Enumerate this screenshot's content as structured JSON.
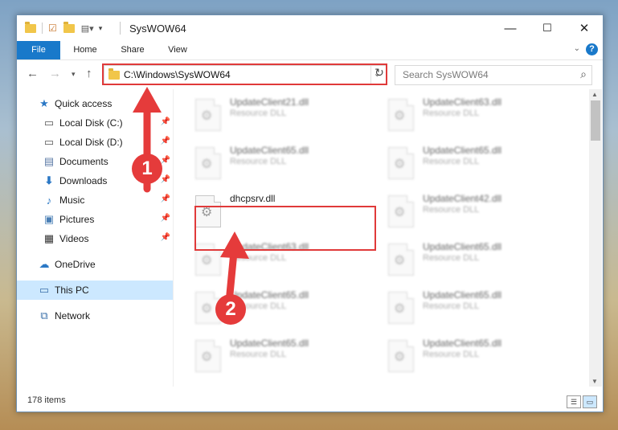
{
  "window": {
    "title": "SysWOW64",
    "controls": {
      "minimize": "—",
      "maximize": "☐",
      "close": "✕"
    }
  },
  "ribbon": {
    "tabs": [
      "File",
      "Home",
      "Share",
      "View"
    ],
    "help": "?"
  },
  "address": {
    "path": "C:\\Windows\\SysWOW64",
    "search_placeholder": "Search SysWOW64"
  },
  "sidebar": {
    "quick_access": "Quick access",
    "items": [
      {
        "label": "Local Disk (C:)",
        "icon": "drive-icon"
      },
      {
        "label": "Local Disk (D:)",
        "icon": "drive-icon"
      },
      {
        "label": "Documents",
        "icon": "documents-icon"
      },
      {
        "label": "Downloads",
        "icon": "downloads-icon"
      },
      {
        "label": "Music",
        "icon": "music-icon"
      },
      {
        "label": "Pictures",
        "icon": "pictures-icon"
      },
      {
        "label": "Videos",
        "icon": "videos-icon"
      }
    ],
    "onedrive": "OneDrive",
    "this_pc": "This PC",
    "network": "Network"
  },
  "files": [
    {
      "name": "UpdateClient21.dll",
      "type": "Resource DLL"
    },
    {
      "name": "UpdateClient63.dll",
      "type": "Resource DLL"
    },
    {
      "name": "UpdateClient65.dll",
      "type": "Resource DLL"
    },
    {
      "name": "UpdateClient65.dll",
      "type": "Resource DLL"
    },
    {
      "name": "dhcpsrv.dll",
      "type": ""
    },
    {
      "name": "UpdateClient42.dll",
      "type": "Resource DLL"
    },
    {
      "name": "UpdateClient63.dll",
      "type": "Resource DLL"
    },
    {
      "name": "UpdateClient65.dll",
      "type": "Resource DLL"
    },
    {
      "name": "UpdateClient65.dll",
      "type": "Resource DLL"
    },
    {
      "name": "UpdateClient65.dll",
      "type": "Resource DLL"
    },
    {
      "name": "UpdateClient65.dll",
      "type": "Resource DLL"
    },
    {
      "name": "UpdateClient65.dll",
      "type": "Resource DLL"
    }
  ],
  "status": {
    "item_count": "178 items"
  },
  "annotations": {
    "step1": "1",
    "step2": "2",
    "color": "#e53b3b"
  }
}
